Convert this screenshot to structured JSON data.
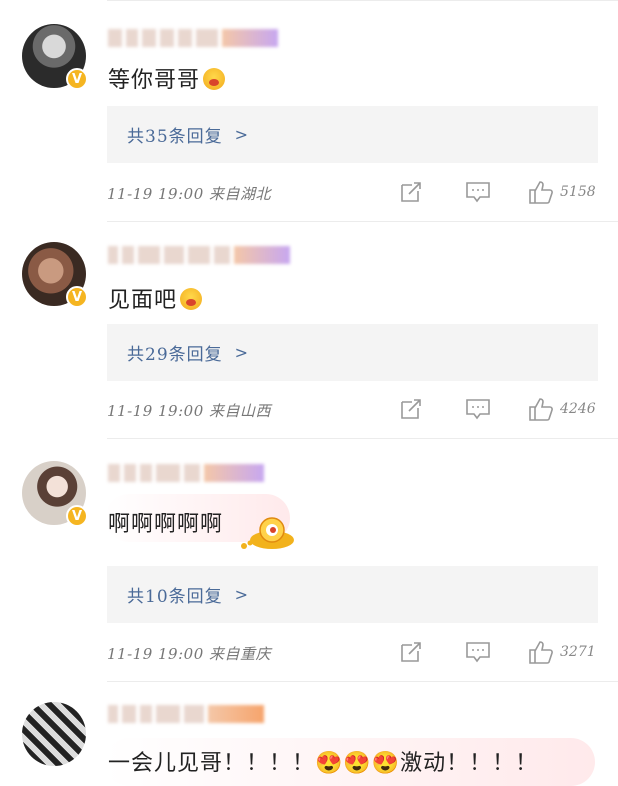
{
  "comments": [
    {
      "text": "等你哥哥",
      "reply_label": "共35条回复",
      "meta": "11-19 19:00 来自湖北",
      "likes": "5158",
      "avatar": "avatar-icon",
      "emoji": "crying-emoji-icon"
    },
    {
      "text": "见面吧",
      "reply_label": "共29条回复",
      "meta": "11-19 19:00 来自山西",
      "likes": "4246",
      "avatar": "avatar-icon",
      "emoji": "kiss-emoji-icon"
    },
    {
      "text": "啊啊啊啊啊",
      "reply_label": "共10条回复",
      "meta": "11-19 19:00 来自重庆",
      "likes": "3271",
      "avatar": "avatar-icon",
      "emoji": "gold-ingot-sticker-icon"
    },
    {
      "text": "一会儿见哥！！！！😍😍😍激动！！！！",
      "avatar": "avatar-icon"
    }
  ],
  "icons": {
    "share": "share-icon",
    "comment": "comment-icon",
    "like": "thumbs-up-icon"
  },
  "colors": {
    "reply_text": "#4a6a98",
    "reply_bg": "#f4f4f4",
    "verified_badge": "#f5b521"
  }
}
